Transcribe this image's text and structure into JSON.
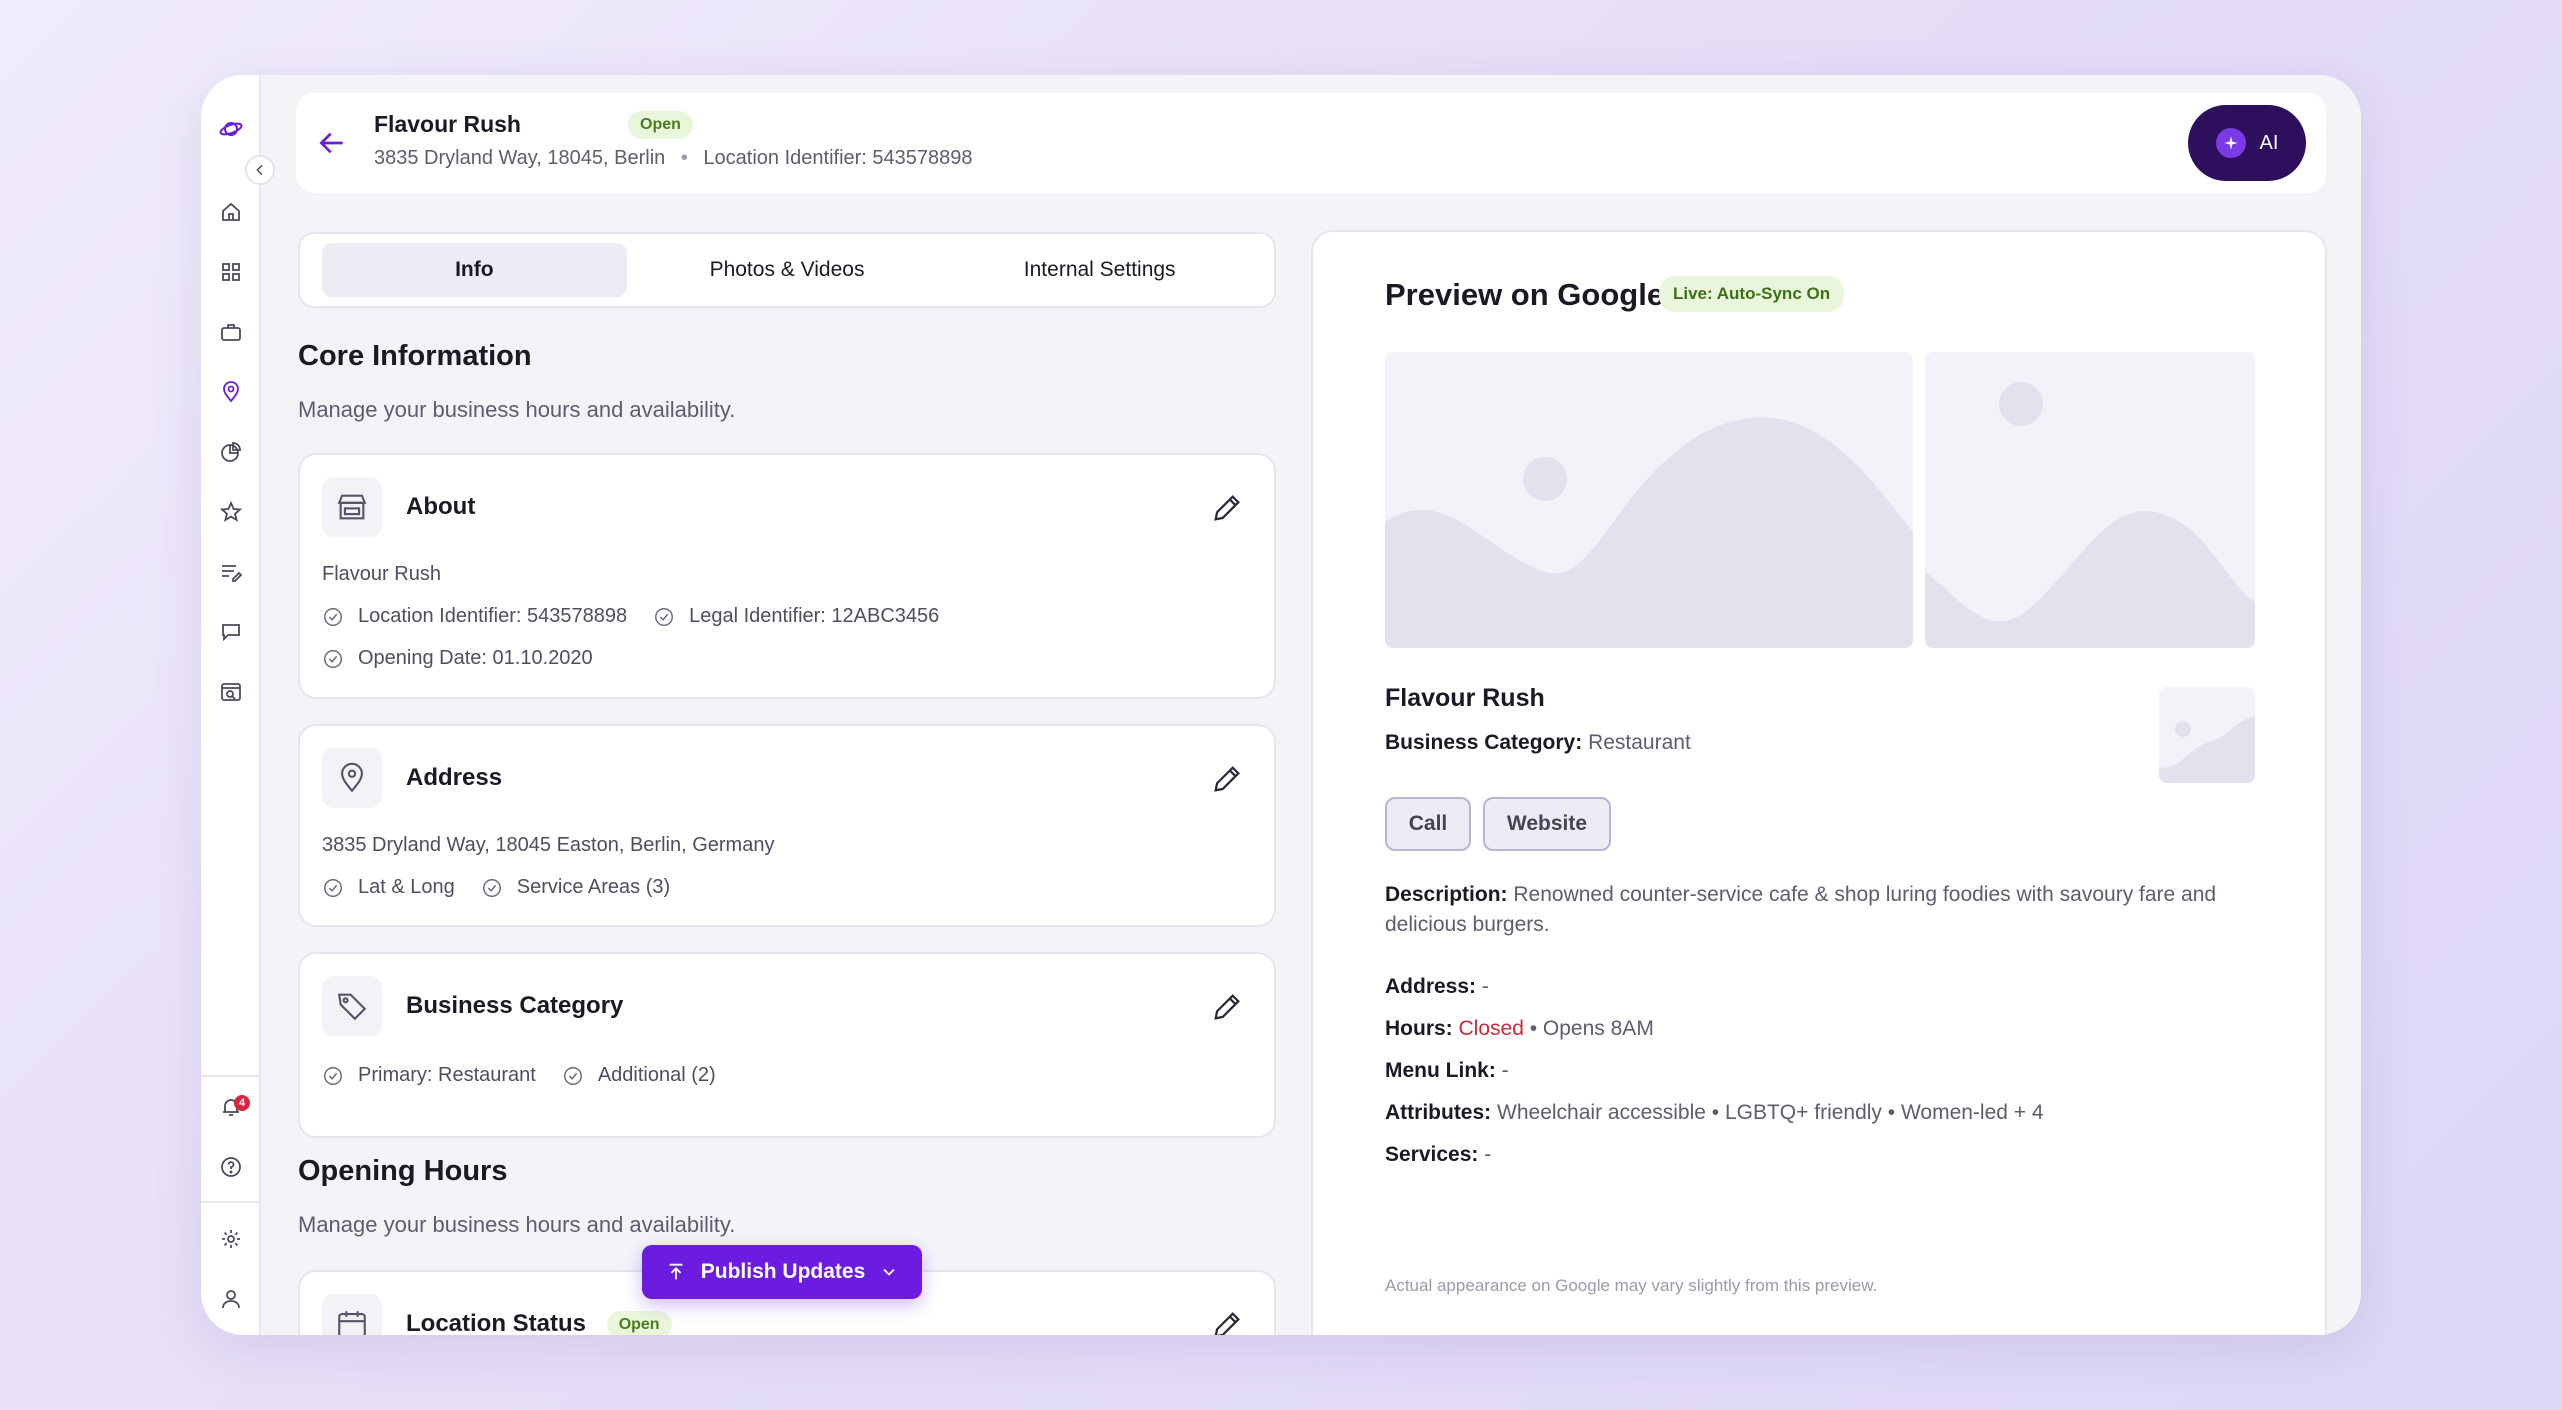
{
  "header": {
    "business_name": "Flavour Rush",
    "status": "Open",
    "address": "3835 Dryland Way, 18045, Berlin",
    "separator": "•",
    "location_identifier": "Location Identifier: 543578898",
    "ai_label": "AI"
  },
  "tabs": [
    {
      "label": "Info",
      "active": true
    },
    {
      "label": "Photos & Videos",
      "active": false
    },
    {
      "label": "Internal Settings",
      "active": false
    }
  ],
  "core": {
    "title": "Core Information",
    "subtitle": "Manage your business hours and availability."
  },
  "about": {
    "title": "About",
    "name": "Flavour Rush",
    "location_identifier": "Location Identifier: 543578898",
    "legal_identifier": "Legal Identifier: 12ABC3456",
    "opening_date": "Opening Date: 01.10.2020"
  },
  "address_card": {
    "title": "Address",
    "full_address": "3835 Dryland Way, 18045 Easton, Berlin, Germany",
    "lat_long": "Lat & Long",
    "service_areas": "Service Areas (3)"
  },
  "category_card": {
    "title": "Business Category",
    "primary": "Primary: Restaurant",
    "additional": "Additional (2)"
  },
  "opening_hours": {
    "title": "Opening Hours",
    "subtitle": "Manage your business hours and availability."
  },
  "location_status": {
    "title": "Location Status",
    "status": "Open"
  },
  "publish": {
    "label": "Publish Updates"
  },
  "notifications": {
    "count": "4"
  },
  "preview": {
    "title": "Preview on Google",
    "sync_label": "Live: Auto-Sync On",
    "name": "Flavour Rush",
    "category_label": "Business Category:",
    "category_value": "Restaurant",
    "call_label": "Call",
    "website_label": "Website",
    "description_label": "Description:",
    "description_value": "Renowned counter-service cafe & shop luring foodies with savoury fare and delicious burgers.",
    "address_label": "Address:",
    "address_value": "-",
    "hours_label": "Hours:",
    "hours_status": "Closed",
    "hours_value": "• Opens 8AM",
    "menu_label": "Menu Link:",
    "menu_value": "-",
    "attributes_label": "Attributes:",
    "attributes_value": "Wheelchair accessible • LGBTQ+ friendly •  Women-led + 4",
    "services_label": "Services:",
    "services_value": "-",
    "disclaimer": "Actual appearance on Google may vary slightly from this preview."
  },
  "colors": {
    "accent": "#6b1ce0",
    "ai_button": "#2e0f5e",
    "open_badge_bg": "#eaf6dc",
    "closed_text": "#c52b3c"
  }
}
